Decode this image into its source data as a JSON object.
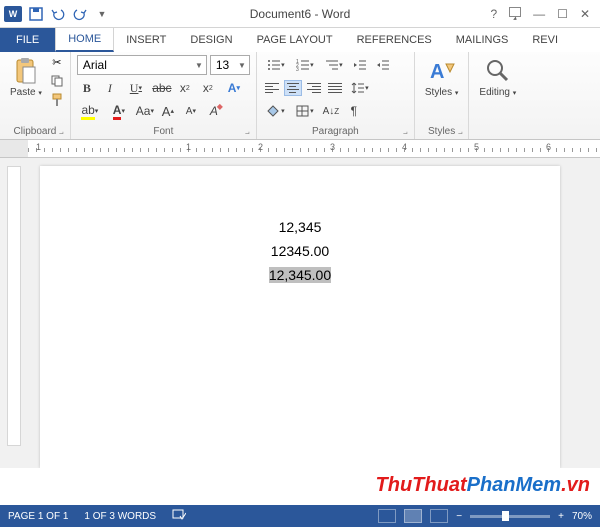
{
  "titlebar": {
    "title": "Document6 - Word"
  },
  "tabs": {
    "file": "FILE",
    "home": "HOME",
    "insert": "INSERT",
    "design": "DESIGN",
    "pagelayout": "PAGE LAYOUT",
    "references": "REFERENCES",
    "mailings": "MAILINGS",
    "review": "REVI"
  },
  "ribbon": {
    "clipboard": {
      "label": "Clipboard",
      "paste": "Paste"
    },
    "font": {
      "label": "Font",
      "name": "Arial",
      "size": "13"
    },
    "paragraph": {
      "label": "Paragraph"
    },
    "styles": {
      "label": "Styles",
      "btn": "Styles"
    },
    "editing": {
      "label": "Editing",
      "btn": "Editing"
    }
  },
  "document": {
    "line1": "12,345",
    "line2": "12345.00",
    "line3": "12,345.00"
  },
  "status": {
    "page": "PAGE 1 OF 1",
    "words": "1 OF 3 WORDS",
    "zoom": "70%"
  },
  "watermark": {
    "part1": "ThuThuat",
    "part2": "PhanMem",
    "part3": ".vn"
  }
}
